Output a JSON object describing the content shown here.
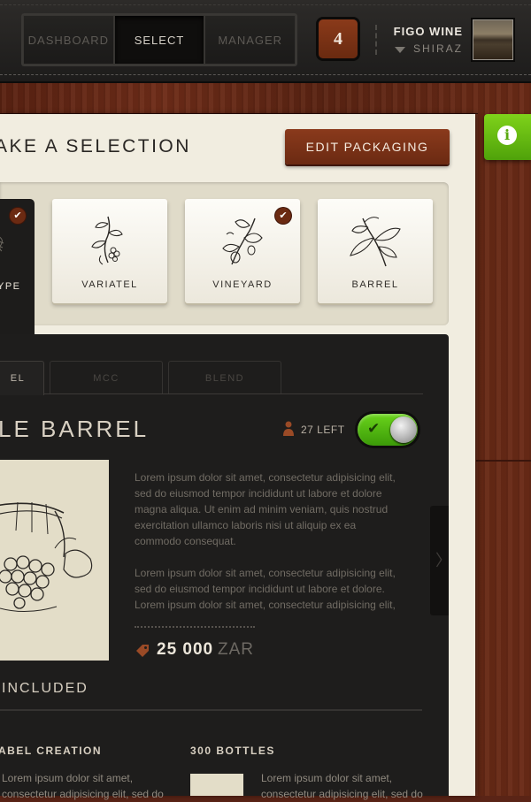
{
  "nav": {
    "tabs": [
      {
        "label": "DASHBOARD",
        "active": false
      },
      {
        "label": "SELECT",
        "active": true
      },
      {
        "label": "MANAGER",
        "active": false
      }
    ],
    "count": "4"
  },
  "wine": {
    "name": "FIGO WINE",
    "variety": "SHIRAZ"
  },
  "selection": {
    "title": "AKE A SELECTION",
    "edit_button": "EDIT PACKAGING",
    "cards": [
      {
        "label": "YPE",
        "selected": true,
        "checked": true,
        "icon": "leaf-icon"
      },
      {
        "label": "VARIATEL",
        "selected": false,
        "checked": false,
        "icon": "grape-vine-icon"
      },
      {
        "label": "VINEYARD",
        "selected": false,
        "checked": true,
        "icon": "fig-branch-icon"
      },
      {
        "label": "BARREL",
        "selected": false,
        "checked": false,
        "icon": "leaf-branch-icon"
      }
    ]
  },
  "product": {
    "tabs": [
      {
        "label": "EL",
        "active": true
      },
      {
        "label": "MCC",
        "active": false
      },
      {
        "label": "BLEND",
        "active": false
      }
    ],
    "title": "LE BARREL",
    "left_count": "27 LEFT",
    "toggle_on": true,
    "desc1": "Lorem ipsum dolor sit amet, consectetur adipisicing elit, sed do eiusmod tempor incididunt ut labore et dolore magna aliqua. Ut enim ad minim veniam, quis nostrud exercitation ullamco laboris nisi ut aliquip ex ea commodo consequat.",
    "desc2": "Lorem ipsum dolor sit amet, consectetur adipisicing elit, sed do eiusmod tempor incididunt ut labore et dolore. Lorem ipsum dolor sit amet, consectetur adipisicing elit,",
    "price": "25 000",
    "currency": "ZAR"
  },
  "included": {
    "title": "INCLUDED",
    "items": [
      {
        "title": "ABEL CREATION",
        "text": "Lorem ipsum dolor sit amet, consectetur adipisicing elit, sed do"
      },
      {
        "title": "300 BOTTLES",
        "text": "Lorem ipsum dolor sit amet, consectetur adipisicing elit, sed do"
      }
    ]
  },
  "colors": {
    "accent": "#7a3216",
    "toggle_green": "#5cc315",
    "info_green": "#6cc214",
    "paper": "#f1ede0",
    "dark_panel": "#1e1d1c"
  }
}
